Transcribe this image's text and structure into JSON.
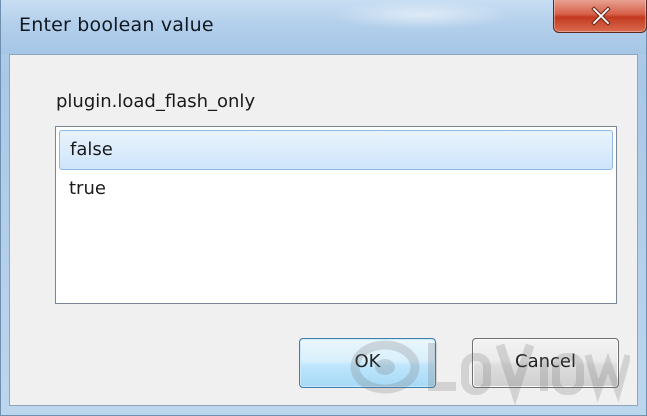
{
  "window": {
    "title": "Enter boolean value"
  },
  "dialog": {
    "prompt": "plugin.load_flash_only",
    "options": [
      {
        "label": "false",
        "selected": true
      },
      {
        "label": "true",
        "selected": false
      }
    ],
    "ok_label": "OK",
    "cancel_label": "Cancel"
  },
  "icons": {
    "close": "close-icon"
  },
  "colors": {
    "close_button": "#c74a32",
    "selection": "#cfe5fb",
    "default_button_border": "#3c7fb1"
  }
}
